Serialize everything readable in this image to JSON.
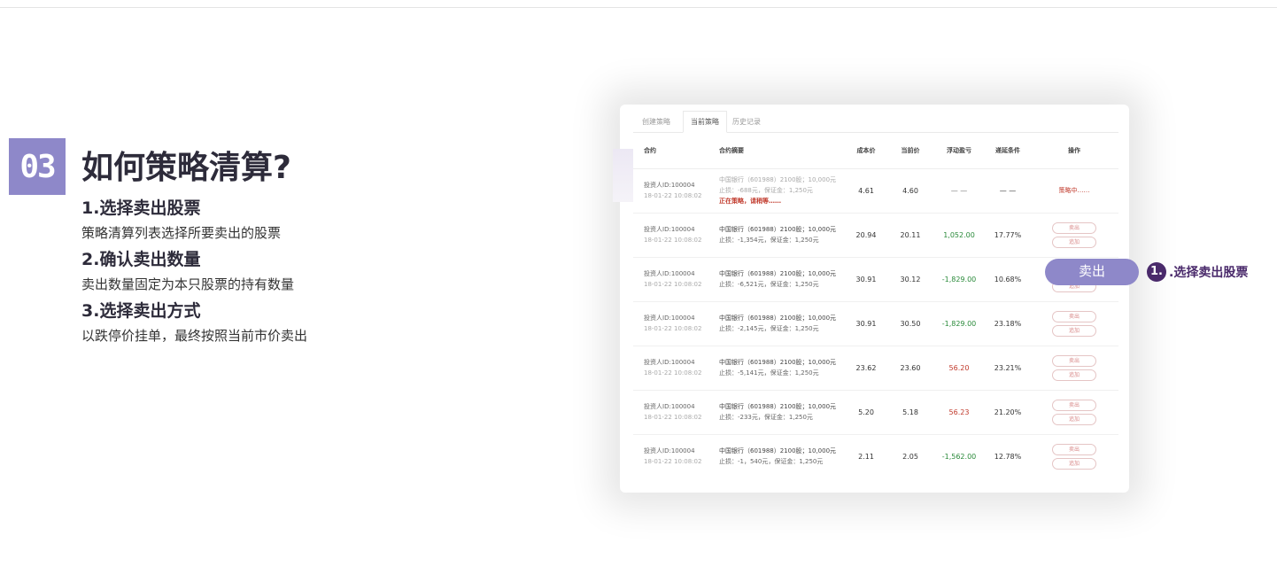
{
  "section_number": "03",
  "title": "如何策略清算?",
  "steps": [
    {
      "heading": "1.选择卖出股票",
      "desc": "策略清算列表选择所要卖出的股票"
    },
    {
      "heading": "2.确认卖出数量",
      "desc": "卖出数量固定为本只股票的持有数量"
    },
    {
      "heading": "3.选择卖出方式",
      "desc": "以跌停价挂单，最终按照当前市价卖出"
    }
  ],
  "screenshot": {
    "tabs": [
      "创建策略",
      "当前策略",
      "历史记录"
    ],
    "active_tab": 1,
    "headers": [
      "合约",
      "合约摘要",
      "成本价",
      "当前价",
      "浮动盈亏",
      "递延条件",
      "操作"
    ],
    "rows": [
      {
        "inv1": "投资人ID:100004",
        "inv2": "18-01-22 10:08:02",
        "s1": "中国银行（601988）2100股；10,000元",
        "s2": "止损：-688元，保证金：1,250元",
        "s3": "正在策略，请稍等……",
        "cost": "4.61",
        "cur": "4.60",
        "pnl": "— —",
        "cond": "— —",
        "op": "策略中……",
        "pnl_color": "dim",
        "faded": true
      },
      {
        "inv1": "投资人ID:100004",
        "inv2": "18-01-22 10:08:02",
        "s1": "中国银行（601988）2100股；10,000元",
        "s2": "止损：-1,354元，保证金：1,250元",
        "s3": "",
        "cost": "20.94",
        "cur": "20.11",
        "pnl": "1,052.00",
        "cond": "17.77%",
        "op": "",
        "pnl_color": "green"
      },
      {
        "inv1": "投资人ID:100004",
        "inv2": "18-01-22 10:08:02",
        "s1": "中国银行（601988）2100股；10,000元",
        "s2": "止损：-6,521元，保证金：1,250元",
        "s3": "",
        "cost": "30.91",
        "cur": "30.12",
        "pnl": "-1,829.00",
        "cond": "10.68%",
        "op": "",
        "pnl_color": "green"
      },
      {
        "inv1": "投资人ID:100004",
        "inv2": "18-01-22 10:08:02",
        "s1": "中国银行（601988）2100股；10,000元",
        "s2": "止损：-2,145元，保证金：1,250元",
        "s3": "",
        "cost": "30.91",
        "cur": "30.50",
        "pnl": "-1,829.00",
        "cond": "23.18%",
        "op": "",
        "pnl_color": "green"
      },
      {
        "inv1": "投资人ID:100004",
        "inv2": "18-01-22 10:08:02",
        "s1": "中国银行（601988）2100股；10,000元",
        "s2": "止损：-5,141元，保证金：1,250元",
        "s3": "",
        "cost": "23.62",
        "cur": "23.60",
        "pnl": "56.20",
        "cond": "23.21%",
        "op": "",
        "pnl_color": "red"
      },
      {
        "inv1": "投资人ID:100004",
        "inv2": "18-01-22 10:08:02",
        "s1": "中国银行（601988）2100股；10,000元",
        "s2": "止损：-233元，保证金：1,250元",
        "s3": "",
        "cost": "5.20",
        "cur": "5.18",
        "pnl": "56.23",
        "cond": "21.20%",
        "op": "",
        "pnl_color": "red"
      },
      {
        "inv1": "投资人ID:100004",
        "inv2": "18-01-22 10:08:02",
        "s1": "中国银行（601988）2100股；10,000元",
        "s2": "止损：-1，540元，保证金：1,250元",
        "s3": "",
        "cost": "2.11",
        "cur": "2.05",
        "pnl": "-1,562.00",
        "cond": "12.78%",
        "op": "",
        "pnl_color": "green"
      }
    ],
    "btn_sell": "卖出",
    "btn_add": "追加"
  },
  "callout": {
    "button": "卖出",
    "number": "1.",
    "text": ".选择卖出股票"
  },
  "colors": {
    "accent": "#8e88c9",
    "callout": "#4a2a6b",
    "loss": "#c0392b",
    "gain": "#2a8a3a"
  }
}
